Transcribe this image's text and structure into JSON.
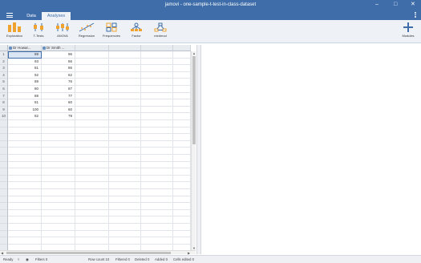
{
  "window": {
    "title": "jamovi - one-sample-t-test-in-class-dataset"
  },
  "menu": {
    "tabs": [
      {
        "label": "Data"
      },
      {
        "label": "Analyses"
      }
    ],
    "active_tab": "Analyses"
  },
  "ribbon": {
    "buttons": [
      {
        "label": "Exploration",
        "icon": "exploration-icon"
      },
      {
        "label": "T-Tests",
        "icon": "t-tests-icon"
      },
      {
        "label": "ANOVA",
        "icon": "anova-icon"
      },
      {
        "label": "Regression",
        "icon": "regression-icon"
      },
      {
        "label": "Frequencies",
        "icon": "frequencies-icon"
      },
      {
        "label": "Factor",
        "icon": "factor-icon"
      },
      {
        "label": "medmod",
        "icon": "medmod-icon"
      }
    ],
    "modules_label": "Modules"
  },
  "sheet": {
    "columns": [
      {
        "name": "Dr Howar..."
      },
      {
        "name": "Dr Smith ..."
      }
    ],
    "row_numbers": [
      "1",
      "2",
      "3",
      "4",
      "5",
      "6",
      "7",
      "8",
      "9",
      "10"
    ],
    "rows": [
      [
        "89",
        "96"
      ],
      [
        "93",
        "66"
      ],
      [
        "81",
        "86"
      ],
      [
        "92",
        "62"
      ],
      [
        "89",
        "76"
      ],
      [
        "80",
        "87"
      ],
      [
        "88",
        "77"
      ],
      [
        "81",
        "60"
      ],
      [
        "100",
        "60"
      ],
      [
        "82",
        "79"
      ]
    ]
  },
  "status": {
    "ready": "Ready",
    "filters": "Filters 0",
    "row_count": "Row count 10",
    "filtered": "Filtered 0",
    "deleted": "Deleted 0",
    "added": "Added 0",
    "cells_edited": "Cells edited 0"
  },
  "colors": {
    "accent": "#3e6da9",
    "ribbon_bg": "#eef2f7",
    "icon_orange": "#f0a22e",
    "icon_blue": "#3e6da9"
  }
}
